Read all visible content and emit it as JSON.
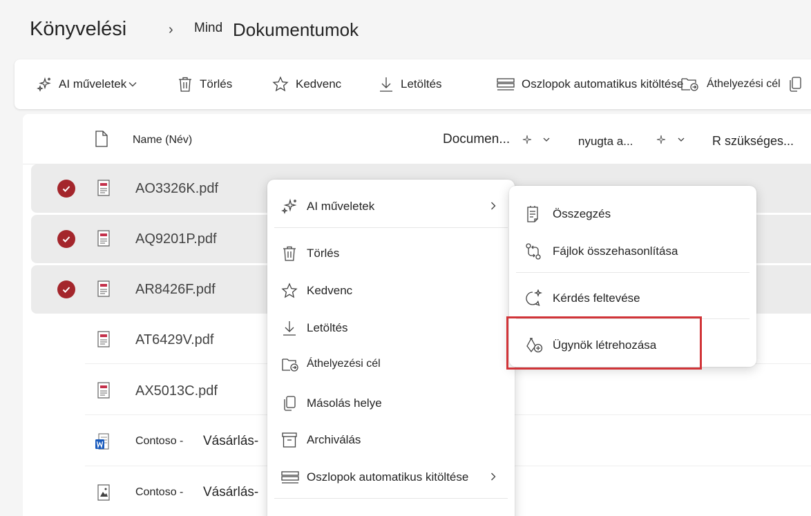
{
  "header": {
    "site_title": "Könyvelési",
    "breadcrumb_separator": "›",
    "breadcrumb_prefix": "Mind",
    "library_title": "Dokumentumok"
  },
  "toolbar": {
    "ai_label": "AI műveletek",
    "delete_label": "Törlés",
    "favorite_label": "Kedvenc",
    "download_label": "Letöltés",
    "autofill_label": "Oszlopok automatikus kitöltése",
    "move_label": "Áthelyezési cél"
  },
  "columns": {
    "name": "Name (Név)",
    "col2": "Documen...",
    "col3": "nyugta a...",
    "col4": "R szükséges..."
  },
  "files": [
    {
      "name": "AO3326K.pdf",
      "type": "pdf",
      "selected": true
    },
    {
      "name": "AQ9201P.pdf",
      "type": "pdf",
      "selected": true
    },
    {
      "name": "AR8426F.pdf",
      "type": "pdf",
      "selected": true
    },
    {
      "name": "AT6429V.pdf",
      "type": "pdf",
      "selected": false
    },
    {
      "name": "AX5013C.pdf",
      "type": "pdf",
      "selected": false
    },
    {
      "name_part1": "Contoso -",
      "name_part2": "Vásárlás-",
      "type": "word",
      "selected": false
    },
    {
      "name_part1": "Contoso -",
      "name_part2": "Vásárlás-",
      "type": "image",
      "selected": false
    }
  ],
  "context_menu": {
    "ai": "AI műveletek",
    "delete": "Törlés",
    "favorite": "Kedvenc",
    "download": "Letöltés",
    "move": "Áthelyezési cél",
    "copy": "Másolás helye",
    "archive": "Archiválás",
    "autofill": "Oszlopok automatikus kitöltése"
  },
  "submenu": {
    "summarize": "Összegzés",
    "compare": "Fájlok összehasonlítása",
    "ask": "Kérdés feltevése",
    "create_agent": "Ügynök létrehozása"
  },
  "colors": {
    "check_red": "#a4262c",
    "highlight_red": "#d13438",
    "word_blue": "#185abd"
  }
}
